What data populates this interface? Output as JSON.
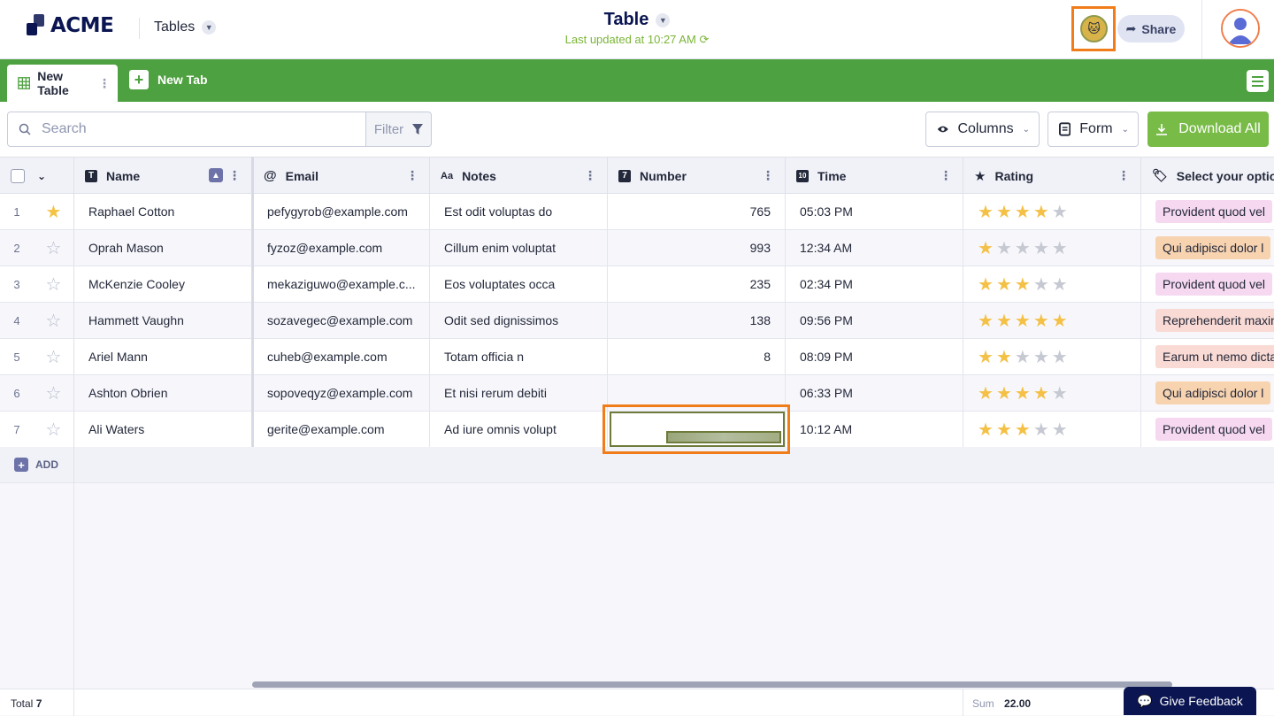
{
  "header": {
    "logo_text": "ACME",
    "nav_label": "Tables",
    "title": "Table",
    "last_updated": "Last updated at 10:27 AM",
    "share_label": "Share"
  },
  "tabs": {
    "active_label": "New Table",
    "new_tab_label": "New Tab"
  },
  "toolbar": {
    "search_placeholder": "Search",
    "filter_label": "Filter",
    "columns_label": "Columns",
    "form_label": "Form",
    "download_label": "Download All"
  },
  "columns": [
    {
      "label": "Name",
      "type_icon": "text-type-icon"
    },
    {
      "label": "Email",
      "type_icon": "at-icon"
    },
    {
      "label": "Notes",
      "type_icon": "Aa"
    },
    {
      "label": "Number",
      "type_icon": "7"
    },
    {
      "label": "Time",
      "type_icon": "calendar-icon"
    },
    {
      "label": "Rating",
      "type_icon": "star-icon"
    },
    {
      "label": "Select your option",
      "type_icon": "tag-icon"
    }
  ],
  "rows": [
    {
      "index": "1",
      "favorite": true,
      "name": "Raphael Cotton",
      "email": "pefygyrob@example.com",
      "notes": "Est odit voluptas do",
      "number": "765",
      "time": "05:03 PM",
      "rating": 4,
      "option": "Provident quod vel",
      "option_color": "#f6d9f0"
    },
    {
      "index": "2",
      "favorite": false,
      "name": "Oprah Mason",
      "email": "fyzoz@example.com",
      "notes": "Cillum enim voluptat",
      "number": "993",
      "time": "12:34 AM",
      "rating": 1,
      "option": "Qui adipisci dolor l",
      "option_color": "#f7d3b0"
    },
    {
      "index": "3",
      "favorite": false,
      "name": "McKenzie Cooley",
      "email": "mekaziguwo@example.c...",
      "notes": "Eos voluptates occa",
      "number": "235",
      "time": "02:34 PM",
      "rating": 3,
      "option": "Provident quod vel",
      "option_color": "#f6d9f0"
    },
    {
      "index": "4",
      "favorite": false,
      "name": "Hammett Vaughn",
      "email": "sozavegec@example.com",
      "notes": "Odit sed dignissimos",
      "number": "138",
      "time": "09:56 PM",
      "rating": 5,
      "option": "Reprehenderit maxin",
      "option_color": "#f9dad4"
    },
    {
      "index": "5",
      "favorite": false,
      "name": "Ariel Mann",
      "email": "cuheb@example.com",
      "notes": "Totam officia n",
      "number": "8",
      "time": "08:09 PM",
      "rating": 2,
      "option": "Earum ut nemo dicta",
      "option_color": "#f9dad4"
    },
    {
      "index": "6",
      "favorite": false,
      "name": "Ashton Obrien",
      "email": "sopoveqyz@example.com",
      "notes": "Et nisi rerum debiti",
      "number": "",
      "time": "06:33 PM",
      "rating": 4,
      "option": "Qui adipisci dolor l",
      "option_color": "#f7d3b0"
    },
    {
      "index": "7",
      "favorite": false,
      "name": "Ali Waters",
      "email": "gerite@example.com",
      "notes": "Ad iure omnis volupt",
      "number": "",
      "time": "10:12 AM",
      "rating": 3,
      "option": "Provident quod vel",
      "option_color": "#f6d9f0"
    }
  ],
  "add_label": "ADD",
  "footer": {
    "total_label": "Total",
    "total_value": "7",
    "sum_label": "Sum",
    "sum_value": "22.00",
    "feedback_label": "Give Feedback"
  },
  "colors": {
    "brand": "#0a1551",
    "tabbar": "#4ea140",
    "download": "#78bb47",
    "highlight": "#f07d1a"
  }
}
